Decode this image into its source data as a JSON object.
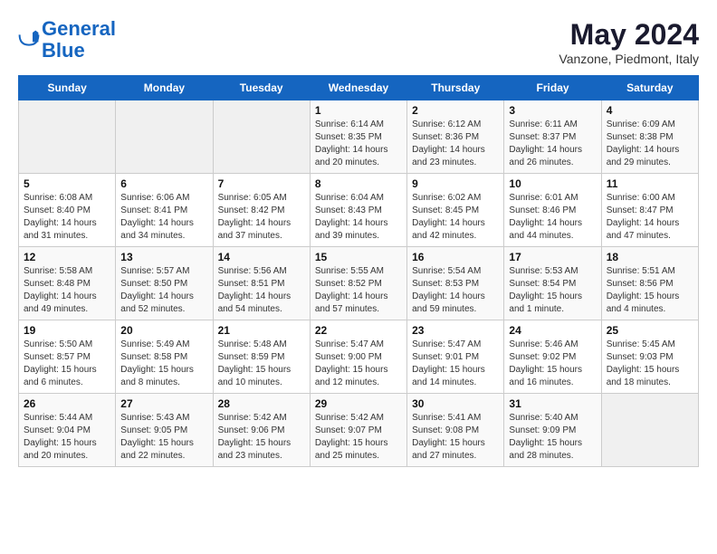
{
  "logo": {
    "line1": "General",
    "line2": "Blue"
  },
  "title": "May 2024",
  "subtitle": "Vanzone, Piedmont, Italy",
  "days_of_week": [
    "Sunday",
    "Monday",
    "Tuesday",
    "Wednesday",
    "Thursday",
    "Friday",
    "Saturday"
  ],
  "weeks": [
    [
      {
        "day": "",
        "info": ""
      },
      {
        "day": "",
        "info": ""
      },
      {
        "day": "",
        "info": ""
      },
      {
        "day": "1",
        "info": "Sunrise: 6:14 AM\nSunset: 8:35 PM\nDaylight: 14 hours\nand 20 minutes."
      },
      {
        "day": "2",
        "info": "Sunrise: 6:12 AM\nSunset: 8:36 PM\nDaylight: 14 hours\nand 23 minutes."
      },
      {
        "day": "3",
        "info": "Sunrise: 6:11 AM\nSunset: 8:37 PM\nDaylight: 14 hours\nand 26 minutes."
      },
      {
        "day": "4",
        "info": "Sunrise: 6:09 AM\nSunset: 8:38 PM\nDaylight: 14 hours\nand 29 minutes."
      }
    ],
    [
      {
        "day": "5",
        "info": "Sunrise: 6:08 AM\nSunset: 8:40 PM\nDaylight: 14 hours\nand 31 minutes."
      },
      {
        "day": "6",
        "info": "Sunrise: 6:06 AM\nSunset: 8:41 PM\nDaylight: 14 hours\nand 34 minutes."
      },
      {
        "day": "7",
        "info": "Sunrise: 6:05 AM\nSunset: 8:42 PM\nDaylight: 14 hours\nand 37 minutes."
      },
      {
        "day": "8",
        "info": "Sunrise: 6:04 AM\nSunset: 8:43 PM\nDaylight: 14 hours\nand 39 minutes."
      },
      {
        "day": "9",
        "info": "Sunrise: 6:02 AM\nSunset: 8:45 PM\nDaylight: 14 hours\nand 42 minutes."
      },
      {
        "day": "10",
        "info": "Sunrise: 6:01 AM\nSunset: 8:46 PM\nDaylight: 14 hours\nand 44 minutes."
      },
      {
        "day": "11",
        "info": "Sunrise: 6:00 AM\nSunset: 8:47 PM\nDaylight: 14 hours\nand 47 minutes."
      }
    ],
    [
      {
        "day": "12",
        "info": "Sunrise: 5:58 AM\nSunset: 8:48 PM\nDaylight: 14 hours\nand 49 minutes."
      },
      {
        "day": "13",
        "info": "Sunrise: 5:57 AM\nSunset: 8:50 PM\nDaylight: 14 hours\nand 52 minutes."
      },
      {
        "day": "14",
        "info": "Sunrise: 5:56 AM\nSunset: 8:51 PM\nDaylight: 14 hours\nand 54 minutes."
      },
      {
        "day": "15",
        "info": "Sunrise: 5:55 AM\nSunset: 8:52 PM\nDaylight: 14 hours\nand 57 minutes."
      },
      {
        "day": "16",
        "info": "Sunrise: 5:54 AM\nSunset: 8:53 PM\nDaylight: 14 hours\nand 59 minutes."
      },
      {
        "day": "17",
        "info": "Sunrise: 5:53 AM\nSunset: 8:54 PM\nDaylight: 15 hours\nand 1 minute."
      },
      {
        "day": "18",
        "info": "Sunrise: 5:51 AM\nSunset: 8:56 PM\nDaylight: 15 hours\nand 4 minutes."
      }
    ],
    [
      {
        "day": "19",
        "info": "Sunrise: 5:50 AM\nSunset: 8:57 PM\nDaylight: 15 hours\nand 6 minutes."
      },
      {
        "day": "20",
        "info": "Sunrise: 5:49 AM\nSunset: 8:58 PM\nDaylight: 15 hours\nand 8 minutes."
      },
      {
        "day": "21",
        "info": "Sunrise: 5:48 AM\nSunset: 8:59 PM\nDaylight: 15 hours\nand 10 minutes."
      },
      {
        "day": "22",
        "info": "Sunrise: 5:47 AM\nSunset: 9:00 PM\nDaylight: 15 hours\nand 12 minutes."
      },
      {
        "day": "23",
        "info": "Sunrise: 5:47 AM\nSunset: 9:01 PM\nDaylight: 15 hours\nand 14 minutes."
      },
      {
        "day": "24",
        "info": "Sunrise: 5:46 AM\nSunset: 9:02 PM\nDaylight: 15 hours\nand 16 minutes."
      },
      {
        "day": "25",
        "info": "Sunrise: 5:45 AM\nSunset: 9:03 PM\nDaylight: 15 hours\nand 18 minutes."
      }
    ],
    [
      {
        "day": "26",
        "info": "Sunrise: 5:44 AM\nSunset: 9:04 PM\nDaylight: 15 hours\nand 20 minutes."
      },
      {
        "day": "27",
        "info": "Sunrise: 5:43 AM\nSunset: 9:05 PM\nDaylight: 15 hours\nand 22 minutes."
      },
      {
        "day": "28",
        "info": "Sunrise: 5:42 AM\nSunset: 9:06 PM\nDaylight: 15 hours\nand 23 minutes."
      },
      {
        "day": "29",
        "info": "Sunrise: 5:42 AM\nSunset: 9:07 PM\nDaylight: 15 hours\nand 25 minutes."
      },
      {
        "day": "30",
        "info": "Sunrise: 5:41 AM\nSunset: 9:08 PM\nDaylight: 15 hours\nand 27 minutes."
      },
      {
        "day": "31",
        "info": "Sunrise: 5:40 AM\nSunset: 9:09 PM\nDaylight: 15 hours\nand 28 minutes."
      },
      {
        "day": "",
        "info": ""
      }
    ]
  ]
}
